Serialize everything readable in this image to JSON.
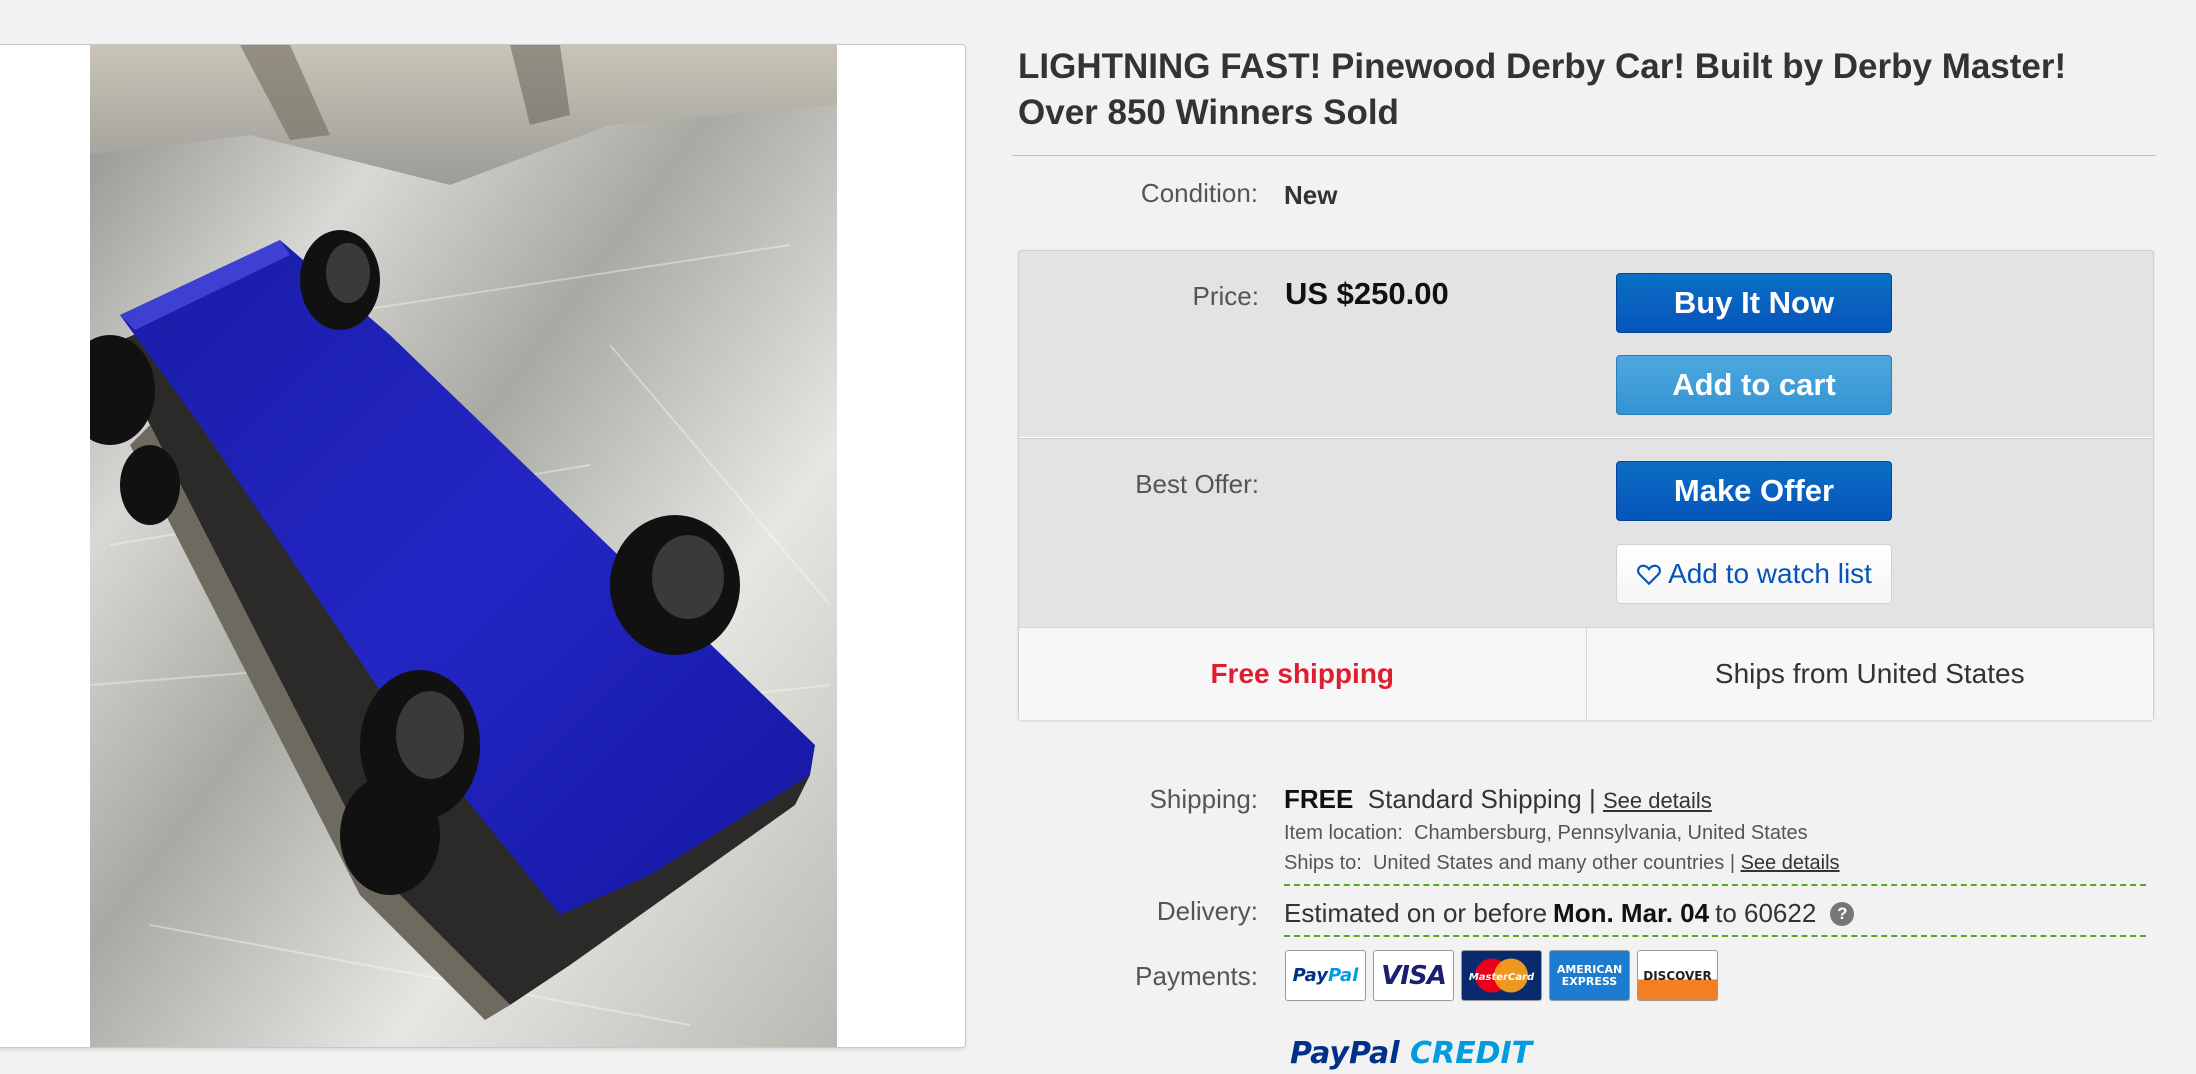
{
  "listing": {
    "title": "LIGHTNING FAST! Pinewood Derby Car! Built by Derby Master! Over 850 Winners Sold",
    "image_alt": "Blue pinewood derby car on a brushed metal surface"
  },
  "condition": {
    "label": "Condition:",
    "value": "New"
  },
  "price": {
    "label": "Price:",
    "value": "US $250.00"
  },
  "buttons": {
    "buy_now": "Buy It Now",
    "add_to_cart": "Add to cart",
    "make_offer": "Make Offer",
    "watch": "Add to watch list"
  },
  "best_offer": {
    "label": "Best Offer:"
  },
  "shipping_strip": {
    "free": "Free shipping",
    "ships_from": "Ships from United States"
  },
  "shipping": {
    "label": "Shipping:",
    "free": "FREE",
    "method": "Standard Shipping |",
    "details_link": "See details",
    "item_location_label": "Item location:",
    "item_location": "Chambersburg, Pennsylvania, United States",
    "ships_to_label": "Ships to:",
    "ships_to": "United States and many other countries |",
    "ships_to_link": "See details"
  },
  "delivery": {
    "label": "Delivery:",
    "prefix": "Estimated on or before",
    "date": "Mon. Mar. 04",
    "to": "to",
    "zip": "60622",
    "help": "?"
  },
  "payments": {
    "label": "Payments:",
    "paypal_a": "Pay",
    "paypal_b": "Pal",
    "visa": "VISA",
    "mastercard": "MasterCard",
    "amex_1": "AMERICAN",
    "amex_2": "EXPRESS",
    "discover": "DISCOVER"
  },
  "paypal_credit": {
    "a": "PayPal",
    "b": "CREDIT"
  },
  "colors": {
    "primary_button": "#0654ba",
    "secondary_button": "#3393d2",
    "free_shipping_red": "#dd1e31",
    "delivery_dash": "#5ba71b",
    "car_blue": "#1c1fb0"
  }
}
